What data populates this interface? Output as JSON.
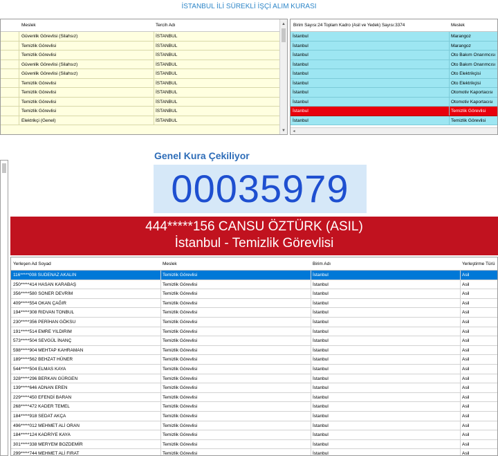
{
  "title": "İSTANBUL İLİ SÜREKLİ İŞÇİ ALIM KURASI",
  "top_left": {
    "columns": [
      "Meslek",
      "Tercih Adı"
    ],
    "rows": [
      [
        "Güvenlik Görevlisi (Silahsız)",
        "İSTANBUL"
      ],
      [
        "Temizlik Görevlisi",
        "İSTANBUL"
      ],
      [
        "Temizlik Görevlisi",
        "İSTANBUL"
      ],
      [
        "Güvenlik Görevlisi (Silahsız)",
        "İSTANBUL"
      ],
      [
        "Güvenlik Görevlisi (Silahsız)",
        "İSTANBUL"
      ],
      [
        "Temizlik Görevlisi",
        "İSTANBUL"
      ],
      [
        "Temizlik Görevlisi",
        "İSTANBUL"
      ],
      [
        "Temizlik Görevlisi",
        "İSTANBUL"
      ],
      [
        "Temizlik Görevlisi",
        "İSTANBUL"
      ],
      [
        "Elektrikçi (Genel)",
        "İSTANBUL"
      ]
    ]
  },
  "top_right": {
    "columns": [
      "Birim Sayısı:24 Toplam Kadro (Asil ve Yedek) Sayısı:3374",
      "Meslek"
    ],
    "rows": [
      [
        "İstanbul",
        "Marangoz"
      ],
      [
        "İstanbul",
        "Marangoz"
      ],
      [
        "İstanbul",
        "Oto Bakım Onarımcısı"
      ],
      [
        "İstanbul",
        "Oto Bakım Onarımcısı"
      ],
      [
        "İstanbul",
        "Oto Elektrikçisi"
      ],
      [
        "İstanbul",
        "Oto Elektrikçisi"
      ],
      [
        "İstanbul",
        "Otomotiv Kaportacısı"
      ],
      [
        "İstanbul",
        "Otomotiv Kaportacısı"
      ],
      [
        "İstanbul",
        "Temizlik Görevlisi"
      ],
      [
        "İstanbul",
        "Temizlik Görevlisi"
      ]
    ],
    "selected_index": 8
  },
  "draw": {
    "label": "Genel Kura Çekiliyor",
    "number": "00035979",
    "winner_line1": "444*****156 CANSU ÖZTÜRK (ASIL)",
    "winner_line2": "İstanbul - Temizlik Görevlisi"
  },
  "bottom": {
    "columns": [
      "Yerleşen Ad Soyad",
      "Meslek",
      "Birim Adı",
      "Yerleştirme Türü"
    ],
    "rows": [
      [
        "116*****008 SUDENAZ AKALIN",
        "Temizlik Görevlisi",
        "İstanbul",
        "Asil"
      ],
      [
        "250*****414 HASAN KARABAŞ",
        "Temizlik Görevlisi",
        "İstanbul",
        "Asil"
      ],
      [
        "356*****580 SONER DEVRİM",
        "Temizlik Görevlisi",
        "İstanbul",
        "Asil"
      ],
      [
        "409*****554 OKAN ÇAĞIR",
        "Temizlik Görevlisi",
        "İstanbul",
        "Asil"
      ],
      [
        "194*****308 RIDVAN TONBUL",
        "Temizlik Görevlisi",
        "İstanbul",
        "Asil"
      ],
      [
        "230*****356 PERİHAN GÖKSU",
        "Temizlik Görevlisi",
        "İstanbul",
        "Asil"
      ],
      [
        "191*****514 EMRE YILDIRIM",
        "Temizlik Görevlisi",
        "İstanbul",
        "Asil"
      ],
      [
        "573*****504 SEVGÜL İNANÇ",
        "Temizlik Görevlisi",
        "İstanbul",
        "Asil"
      ],
      [
        "598*****904 MEHTAP KAHRAMAN",
        "Temizlik Görevlisi",
        "İstanbul",
        "Asil"
      ],
      [
        "189*****562 BEHZAT HÜNER",
        "Temizlik Görevlisi",
        "İstanbul",
        "Asil"
      ],
      [
        "544*****504 ELMAS KAYA",
        "Temizlik Görevlisi",
        "İstanbul",
        "Asil"
      ],
      [
        "328*****296 BERKAN GÜRGEN",
        "Temizlik Görevlisi",
        "İstanbul",
        "Asil"
      ],
      [
        "139*****646 ADNAN EREN",
        "Temizlik Görevlisi",
        "İstanbul",
        "Asil"
      ],
      [
        "229*****450 EFENDİ BARAN",
        "Temizlik Görevlisi",
        "İstanbul",
        "Asil"
      ],
      [
        "268*****472 KADER TEMEL",
        "Temizlik Görevlisi",
        "İstanbul",
        "Asil"
      ],
      [
        "184*****918 SEDAT AKÇA",
        "Temizlik Görevlisi",
        "İstanbul",
        "Asil"
      ],
      [
        "496*****012 MEHMET ALİ ORAN",
        "Temizlik Görevlisi",
        "İstanbul",
        "Asil"
      ],
      [
        "184*****124 KADRİYE KAYA",
        "Temizlik Görevlisi",
        "İstanbul",
        "Asil"
      ],
      [
        "301*****338 MERYEM BOZDEMİR",
        "Temizlik Görevlisi",
        "İstanbul",
        "Asil"
      ],
      [
        "299*****744 MEHMET ALİ FIRAT",
        "Temizlik Görevlisi",
        "İstanbul",
        "Asil"
      ]
    ],
    "selected_index": 0
  }
}
